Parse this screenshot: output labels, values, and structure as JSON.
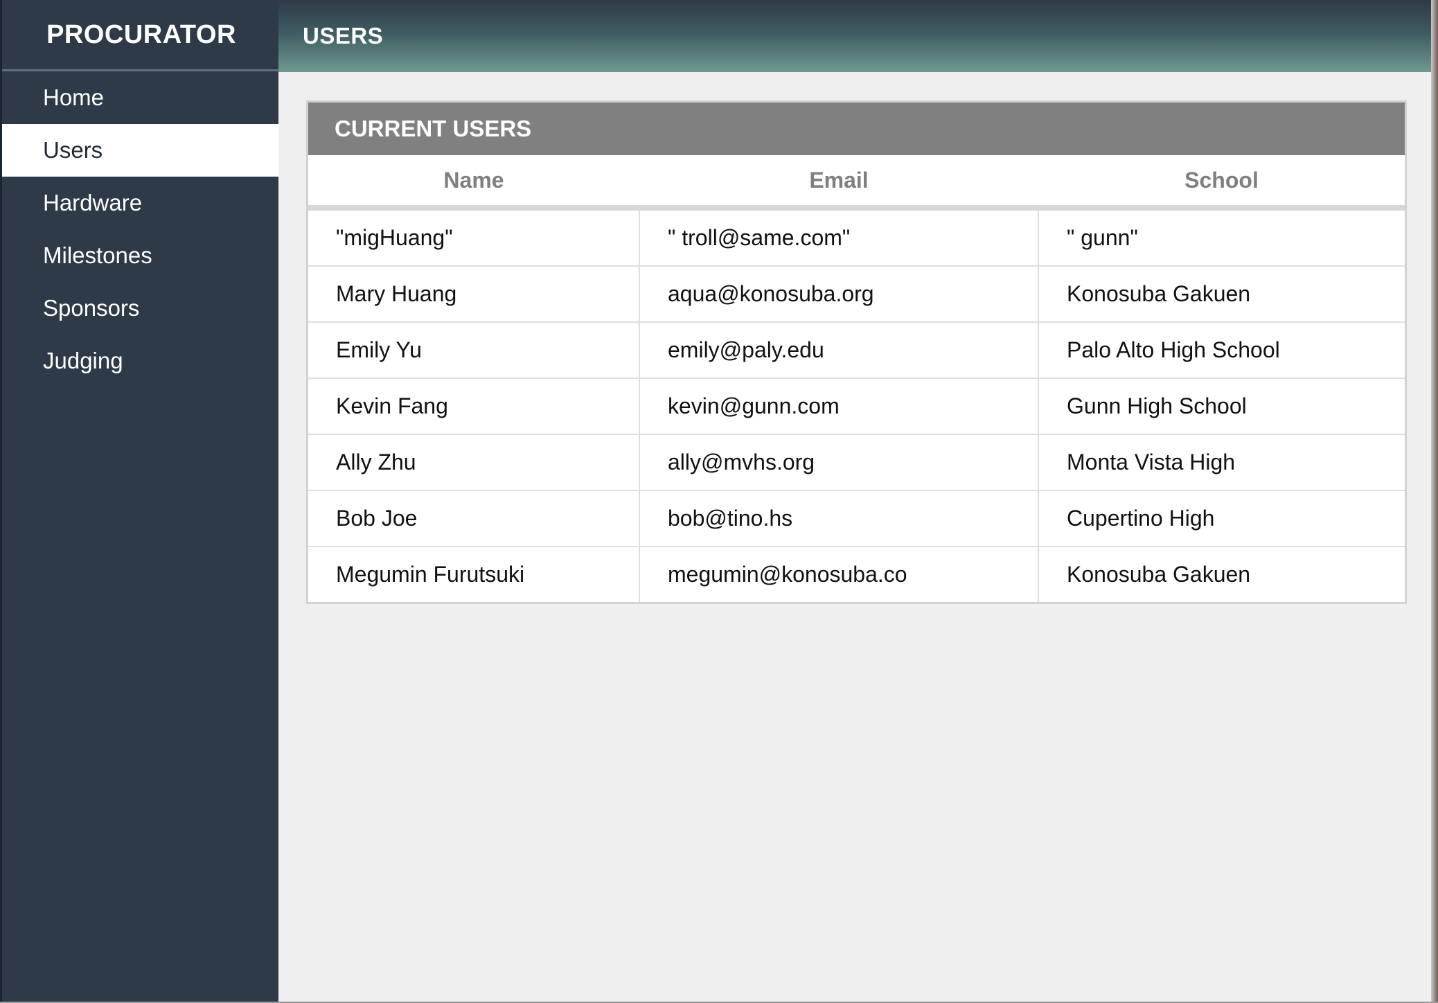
{
  "app": {
    "brand": "PROCURATOR",
    "page_title": "USERS"
  },
  "sidebar": {
    "items": [
      {
        "label": "Home",
        "active": false
      },
      {
        "label": "Users",
        "active": true
      },
      {
        "label": "Hardware",
        "active": false
      },
      {
        "label": "Milestones",
        "active": false
      },
      {
        "label": "Sponsors",
        "active": false
      },
      {
        "label": "Judging",
        "active": false
      }
    ]
  },
  "panel": {
    "title": "CURRENT USERS",
    "columns": [
      "Name",
      "Email",
      "School"
    ],
    "rows": [
      [
        "\"migHuang\"",
        "\" troll@same.com\"",
        "\" gunn\""
      ],
      [
        "Mary Huang",
        "aqua@konosuba.org",
        "Konosuba Gakuen"
      ],
      [
        "Emily Yu",
        "emily@paly.edu",
        "Palo Alto High School"
      ],
      [
        "Kevin Fang",
        "kevin@gunn.com",
        "Gunn High School"
      ],
      [
        "Ally Zhu",
        "ally@mvhs.org",
        "Monta Vista High"
      ],
      [
        "Bob Joe",
        "bob@tino.hs",
        "Cupertino High"
      ],
      [
        "Megumin Furutsuki",
        "megumin@konosuba.co",
        "Konosuba Gakuen"
      ]
    ]
  },
  "colors": {
    "sidebar_bg": "#2e3a47",
    "header_gradient_end": "#6e9a8e",
    "panel_header_bg": "#808080",
    "content_bg": "#efefef"
  }
}
